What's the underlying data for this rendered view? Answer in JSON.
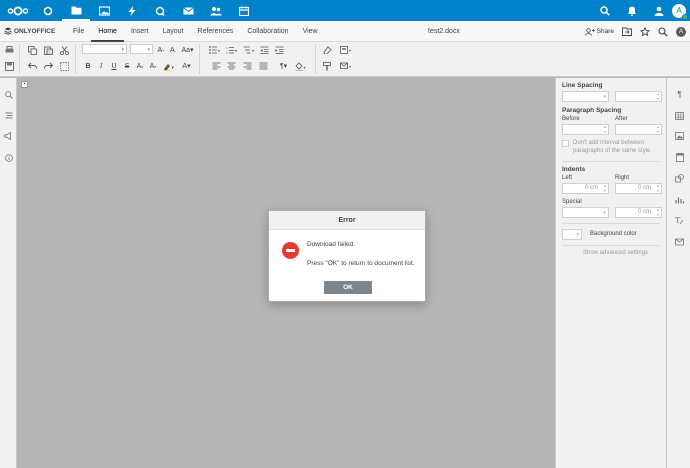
{
  "nextcloud": {
    "apps": [
      "dashboard",
      "files",
      "photos",
      "activity",
      "talk",
      "mail",
      "contacts",
      "calendar"
    ],
    "active_app": "files",
    "right_icons": [
      "search",
      "notifications",
      "contacts-menu"
    ],
    "avatar_letter": "A"
  },
  "editor": {
    "brand": "ONLYOFFICE",
    "tabs": [
      "File",
      "Home",
      "Insert",
      "Layout",
      "References",
      "Collaboration",
      "View"
    ],
    "active_tab": "Home",
    "document_title": "test2.docx",
    "share_label": "Share",
    "user_initial": "A"
  },
  "right_panel": {
    "line_spacing_heading": "Line Spacing",
    "paragraph_spacing_heading": "Paragraph Spacing",
    "before_label": "Before",
    "after_label": "After",
    "dont_add_interval_label": "Don't add interval between",
    "dont_add_interval_label2": "paragraphs of the same style",
    "indents_heading": "Indents",
    "left_label": "Left",
    "right_label": "Right",
    "left_value": "0 cm",
    "right_value": "0 cm",
    "special_label": "Special",
    "special_value": "0 cm",
    "background_color_label": "Background color",
    "show_advanced_label": "Show advanced settings"
  },
  "dialog": {
    "title": "Error",
    "message": "Download failed.",
    "instruction": "Press \"OK\" to return to document list.",
    "ok_label": "OK"
  },
  "colors": {
    "nextcloud_blue": "#0082c9",
    "error_red": "#ea3a2f",
    "ok_button": "#7d858c"
  }
}
